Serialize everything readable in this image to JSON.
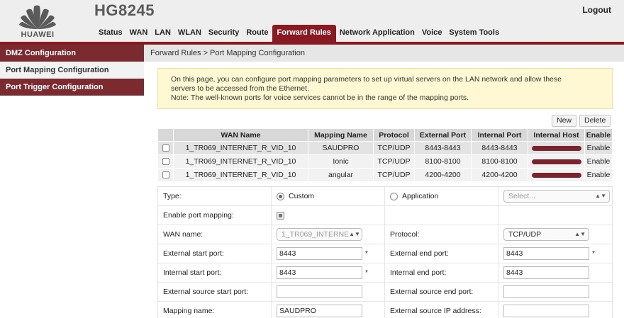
{
  "header": {
    "brand": "HUAWEI",
    "model": "HG8245",
    "logout": "Logout",
    "nav": [
      "Status",
      "WAN",
      "LAN",
      "WLAN",
      "Security",
      "Route",
      "Forward Rules",
      "Network Application",
      "Voice",
      "System Tools"
    ],
    "active_nav": "Forward Rules"
  },
  "sidebar": {
    "items": [
      {
        "label": "DMZ Configuration",
        "style": "dark"
      },
      {
        "label": "Port Mapping Configuration",
        "style": "light"
      },
      {
        "label": "Port Trigger Configuration",
        "style": "dark"
      }
    ]
  },
  "breadcrumb": "Forward Rules > Port Mapping Configuration",
  "note": {
    "line1": "On this page, you can configure port mapping parameters to set up virtual servers on the LAN network and allow these",
    "line2": "servers to be accessed from the Ethernet.",
    "line3": "Note: The well-known ports for voice services cannot be in the range of the mapping ports."
  },
  "buttons": {
    "new": "New",
    "delete": "Delete"
  },
  "table": {
    "headers": [
      "WAN Name",
      "Mapping Name",
      "Protocol",
      "External Port",
      "Internal Port",
      "Internal Host",
      "Enable"
    ],
    "rows": [
      {
        "wan": "1_TR069_INTERNET_R_VID_10",
        "name": "SAUDPRO",
        "protocol": "TCP/UDP",
        "ext": "8443-8443",
        "int": "8443-8443",
        "enable": "Enable"
      },
      {
        "wan": "1_TR069_INTERNET_R_VID_10",
        "name": "Ionic",
        "protocol": "TCP/UDP",
        "ext": "8100-8100",
        "int": "8100-8100",
        "enable": "Enable"
      },
      {
        "wan": "1_TR069_INTERNET_R_VID_10",
        "name": "angular",
        "protocol": "TCP/UDP",
        "ext": "4200-4200",
        "int": "4200-4200",
        "enable": "Enable"
      }
    ]
  },
  "form": {
    "type_label": "Type:",
    "custom": "Custom",
    "application": "Application",
    "select_placeholder": "Select...",
    "enable_label": "Enable port mapping:",
    "wan_label": "WAN name:",
    "wan_value": "1_TR069_INTERNE",
    "protocol_label": "Protocol:",
    "protocol_value": "TCP/UDP",
    "ext_start_label": "External start port:",
    "ext_start_value": "8443",
    "ext_end_label": "External end port:",
    "ext_end_value": "8443",
    "int_start_label": "Internal start port:",
    "int_start_value": "8443",
    "int_end_label": "Internal end port:",
    "int_end_value": "8443",
    "src_start_label": "External source start port:",
    "src_end_label": "External source end port:",
    "mapping_label": "Mapping name:",
    "mapping_value": "SAUDPRO",
    "src_ip_label": "External source IP address:",
    "required": "*"
  },
  "colors": {
    "accent": "#891a21",
    "sidebar_dark": "#7b2a30",
    "note_bg": "#fff8d2"
  }
}
